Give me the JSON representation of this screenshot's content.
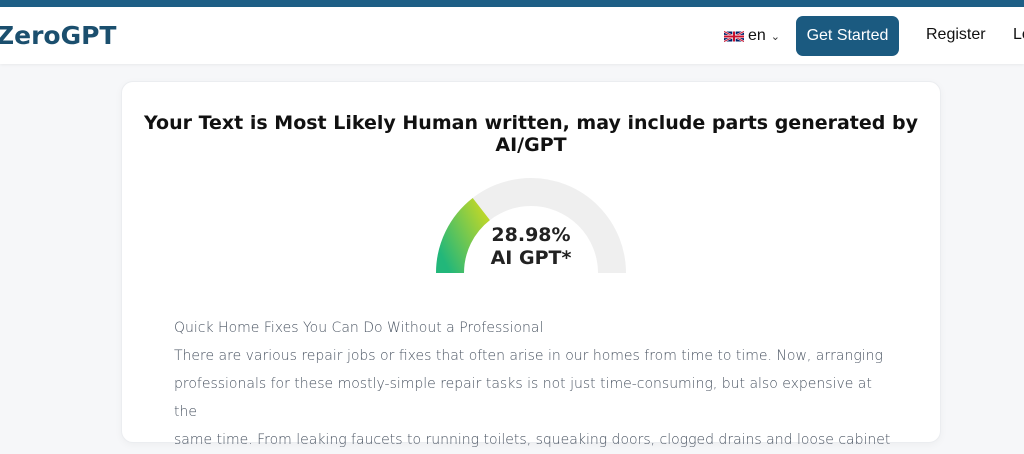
{
  "header": {
    "logo": "ZeroGPT",
    "language": "en",
    "get_started": "Get Started",
    "register": "Register",
    "login_partial": "Lo"
  },
  "colors": {
    "accent": "#1b5a80",
    "gauge_start": "#22b77a",
    "gauge_end": "#b9d62c",
    "gauge_track": "#efefef"
  },
  "result": {
    "title": "Your Text is Most Likely Human written, may include parts generated by AI/GPT",
    "percentage": "28.98%",
    "percentage_value": 28.98,
    "label": "AI GPT*"
  },
  "text": {
    "heading": "Quick Home Fixes You Can Do Without a Professional",
    "lines": [
      "There are various repair jobs or fixes that often arise in our homes from time to time. Now, arranging",
      "professionals for these mostly-simple repair tasks is not just time-consuming, but also expensive at the",
      "same time. From leaking faucets to running toilets, squeaking doors, clogged drains and loose cabinet"
    ]
  }
}
